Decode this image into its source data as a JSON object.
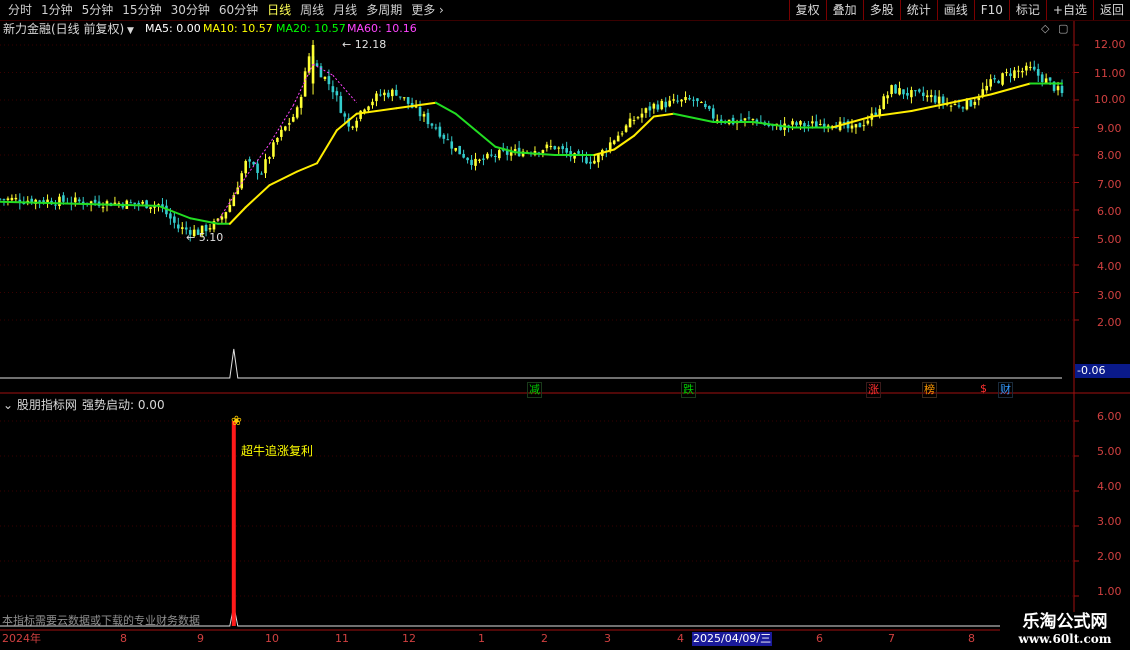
{
  "toolbar": {
    "periods": [
      "分时",
      "1分钟",
      "5分钟",
      "15分钟",
      "30分钟",
      "60分钟",
      "日线",
      "周线",
      "月线",
      "多周期",
      "更多"
    ],
    "active_period": "日线",
    "more_icon": "chevron-right-icon",
    "buttons": [
      "复权",
      "叠加",
      "多股",
      "统计",
      "画线",
      "F10",
      "标记",
      "+自选",
      "返回"
    ]
  },
  "main_chart": {
    "title": "新力金融(日线 前复权)",
    "dropdown_icon": "chevron-down-icon",
    "ma": [
      {
        "label": "MA5: 0.00",
        "color": "#ffffff"
      },
      {
        "label": "MA10: 10.57",
        "color": "#ffff00"
      },
      {
        "label": "MA20: 10.57",
        "color": "#00ff00"
      },
      {
        "label": "MA60: 10.16",
        "color": "#ff00ff"
      }
    ],
    "high_marker": "12.18",
    "low_marker": "5.10",
    "y_ticks": [
      "12.00",
      "11.00",
      "10.00",
      "9.00",
      "8.00",
      "7.00",
      "6.00",
      "5.00",
      "4.00",
      "3.00",
      "2.00"
    ],
    "current_value": "-0.06",
    "badges": [
      {
        "text": "减",
        "color": "#00d000"
      },
      {
        "text": "跌",
        "color": "#00d000"
      },
      {
        "text": "涨",
        "color": "#ff3030"
      },
      {
        "text": "榜",
        "color": "#ff9900"
      },
      {
        "text": "$",
        "color": "#ff3030"
      },
      {
        "text": "财",
        "color": "#3399ff"
      }
    ]
  },
  "indicator": {
    "name": "股朋指标网",
    "value_label": "强势启动: 0.00",
    "signal_text": "超牛追涨复利",
    "y_ticks": [
      "6.00",
      "5.00",
      "4.00",
      "3.00",
      "2.00",
      "1.00"
    ],
    "notice": "本指标需要云数据或下载的专业财务数据"
  },
  "x_axis": {
    "labels": [
      "2024年",
      "8",
      "9",
      "10",
      "11",
      "12",
      "1",
      "2",
      "3",
      "4",
      "2025/04/09/三",
      "6",
      "7",
      "8"
    ]
  },
  "watermark": {
    "line1": "乐淘公式网",
    "line2": "www.60lt.com"
  },
  "chart_data": {
    "type": "candlestick",
    "title": "新力金融(日线 前复权)",
    "ylim": [
      1.5,
      12.5
    ],
    "y_ticks": [
      12,
      11,
      10,
      9,
      8,
      7,
      6,
      5,
      4,
      3,
      2
    ],
    "x_labels": [
      "2024年",
      "8",
      "9",
      "10",
      "11",
      "12",
      "1",
      "2",
      "3",
      "4",
      "2025/04/09/三",
      "6",
      "7",
      "8"
    ],
    "close_path": [
      [
        0,
        6.4
      ],
      [
        10,
        6.35
      ],
      [
        20,
        6.3
      ],
      [
        30,
        6.25
      ],
      [
        40,
        6.2
      ],
      [
        45,
        5.35
      ],
      [
        50,
        5.2
      ],
      [
        55,
        5.55
      ],
      [
        58,
        6.2
      ],
      [
        62,
        7.7
      ],
      [
        66,
        7.4
      ],
      [
        70,
        8.6
      ],
      [
        75,
        9.6
      ],
      [
        78,
        11.6
      ],
      [
        80,
        11.2
      ],
      [
        84,
        10.4
      ],
      [
        88,
        9.0
      ],
      [
        92,
        9.8
      ],
      [
        96,
        10.2
      ],
      [
        100,
        10.3
      ],
      [
        105,
        9.6
      ],
      [
        110,
        9.0
      ],
      [
        115,
        8.2
      ],
      [
        120,
        7.7
      ],
      [
        125,
        8.0
      ],
      [
        130,
        8.1
      ],
      [
        135,
        8.2
      ],
      [
        140,
        8.3
      ],
      [
        145,
        7.9
      ],
      [
        150,
        7.8
      ],
      [
        155,
        8.6
      ],
      [
        160,
        9.3
      ],
      [
        165,
        9.8
      ],
      [
        170,
        9.9
      ],
      [
        175,
        10.0
      ],
      [
        180,
        9.4
      ],
      [
        185,
        9.2
      ],
      [
        190,
        9.3
      ],
      [
        195,
        9.0
      ],
      [
        200,
        9.1
      ],
      [
        205,
        9.1
      ],
      [
        210,
        9.2
      ],
      [
        215,
        8.9
      ],
      [
        220,
        9.4
      ],
      [
        225,
        10.4
      ],
      [
        230,
        10.2
      ],
      [
        235,
        10.1
      ],
      [
        240,
        9.8
      ],
      [
        245,
        9.9
      ],
      [
        250,
        10.6
      ],
      [
        255,
        11.0
      ],
      [
        260,
        11.1
      ],
      [
        265,
        10.6
      ],
      [
        268,
        10.2
      ]
    ],
    "ma_green": [
      [
        0,
        6.3
      ],
      [
        40,
        6.15
      ],
      [
        48,
        5.7
      ],
      [
        55,
        5.5
      ],
      [
        58,
        5.5
      ],
      [
        62,
        6.1
      ],
      [
        68,
        6.9
      ],
      [
        75,
        7.4
      ],
      [
        80,
        7.7
      ],
      [
        85,
        8.9
      ],
      [
        90,
        9.5
      ],
      [
        100,
        9.7
      ],
      [
        110,
        9.9
      ],
      [
        115,
        9.5
      ],
      [
        120,
        8.9
      ],
      [
        125,
        8.3
      ],
      [
        130,
        8.1
      ],
      [
        140,
        8.0
      ],
      [
        150,
        8.0
      ],
      [
        155,
        8.2
      ],
      [
        160,
        8.7
      ],
      [
        165,
        9.4
      ],
      [
        170,
        9.5
      ],
      [
        180,
        9.2
      ],
      [
        190,
        9.2
      ],
      [
        200,
        9.0
      ],
      [
        210,
        9.0
      ],
      [
        220,
        9.4
      ],
      [
        230,
        9.6
      ],
      [
        240,
        9.9
      ],
      [
        250,
        10.2
      ],
      [
        260,
        10.6
      ],
      [
        268,
        10.6
      ]
    ],
    "indicator": {
      "ylim": [
        0.7,
        6.4
      ],
      "signal": {
        "x": 59,
        "value": 6.0,
        "label": "超牛追涨复利"
      }
    }
  }
}
